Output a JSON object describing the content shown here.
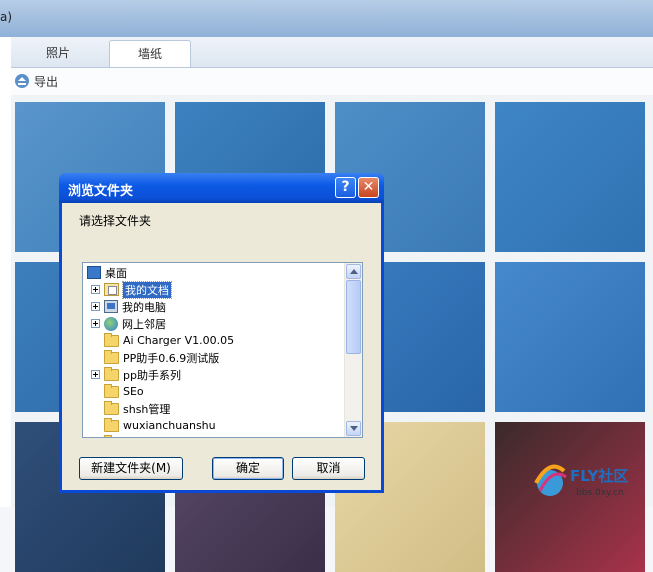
{
  "app": {
    "title_fragment": "a)",
    "tabs": [
      {
        "label": "照片",
        "active": false
      },
      {
        "label": "墙纸",
        "active": true
      }
    ],
    "toolbar": {
      "export_label": "导出"
    },
    "thumbnails": [
      {
        "color_a": "#5a96cc",
        "color_b": "#3f7fba"
      },
      {
        "color_a": "#3d82c0",
        "color_b": "#2a6aa8"
      },
      {
        "color_a": "#4f8fc8",
        "color_b": "#3a79b5"
      },
      {
        "color_a": "#3f86c6",
        "color_b": "#2f72b2"
      },
      {
        "color_a": "#3d7ebd",
        "color_b": "#2d6ba8"
      },
      {
        "color_a": "#3a78b8",
        "color_b": "#2b67a5"
      },
      {
        "color_a": "#3a7cc0",
        "color_b": "#2866a8"
      },
      {
        "color_a": "#4689cc",
        "color_b": "#2f71b4"
      },
      {
        "color_a": "#2f4f7a",
        "color_b": "#203a5c"
      },
      {
        "color_a": "#5a4a6a",
        "color_b": "#3a2f48"
      },
      {
        "color_a": "#e8d7a6",
        "color_b": "#d1bd86"
      },
      {
        "color_a": "#3a2a2a",
        "color_b": "#a8324a"
      }
    ]
  },
  "dialog": {
    "title": "浏览文件夹",
    "help_glyph": "?",
    "close_glyph": "✕",
    "prompt": "请选择文件夹",
    "tree": [
      {
        "label": "桌面",
        "icon": "desktop-icon",
        "expander": false,
        "selected": false
      },
      {
        "label": "我的文档",
        "icon": "my-documents-icon",
        "expander": true,
        "selected": true
      },
      {
        "label": "我的电脑",
        "icon": "my-computer-icon",
        "expander": true,
        "selected": false
      },
      {
        "label": "网上邻居",
        "icon": "network-icon",
        "expander": true,
        "selected": false
      },
      {
        "label": "Ai Charger V1.00.05",
        "icon": "folder-icon",
        "expander": false,
        "selected": false
      },
      {
        "label": "PP助手0.6.9测试版",
        "icon": "folder-icon",
        "expander": false,
        "selected": false
      },
      {
        "label": "pp助手系列",
        "icon": "folder-icon",
        "expander": true,
        "selected": false
      },
      {
        "label": "SEo",
        "icon": "folder-icon",
        "expander": false,
        "selected": false
      },
      {
        "label": "shsh管理",
        "icon": "folder-icon",
        "expander": false,
        "selected": false
      },
      {
        "label": "wuxianchuanshu",
        "icon": "folder-icon",
        "expander": false,
        "selected": false
      },
      {
        "label": "常用美化工具",
        "icon": "folder-icon",
        "expander": true,
        "selected": false
      }
    ],
    "buttons": {
      "new_folder": "新建文件夹(M)",
      "ok": "确定",
      "cancel": "取消"
    }
  },
  "watermark": {
    "brand": "FLY社区",
    "site": "bbs.0xy.cn"
  }
}
